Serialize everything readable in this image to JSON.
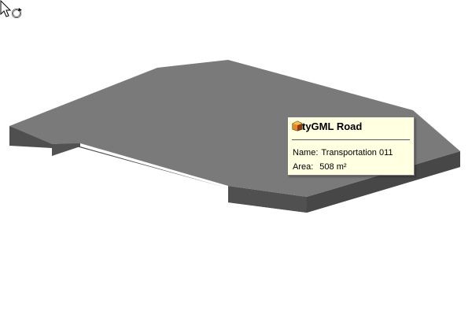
{
  "tooltip": {
    "title": "CityGML Road",
    "icon": "road-object-icon",
    "rows": [
      {
        "label": "Name:",
        "value": "Transportation 011"
      },
      {
        "label": "Area:",
        "value": "508 m²"
      }
    ]
  },
  "cursor": {
    "icon": "arrow-rotate-cursor-icon"
  },
  "colors": {
    "background": "#ffffff",
    "road_top": "#7a7a7a",
    "road_side": "#4f4f4f",
    "tooltip_bg": "#ffffe1"
  }
}
